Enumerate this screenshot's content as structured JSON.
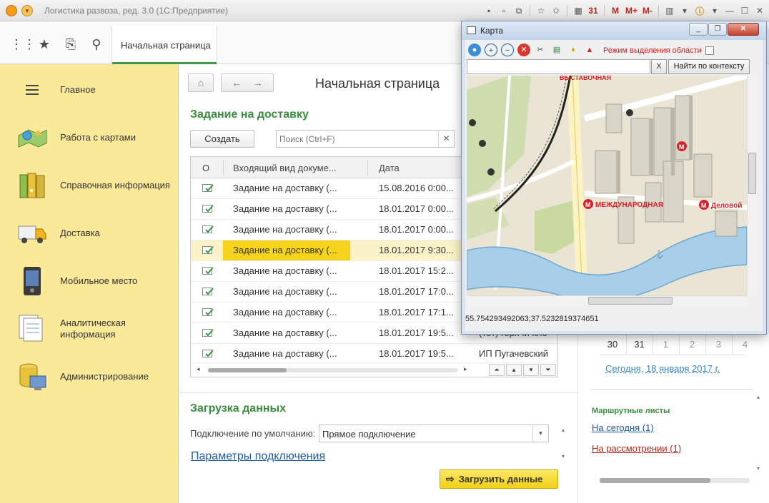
{
  "window": {
    "title": "Логистика развоза, ред. 3.0 (1С:Предприятие)",
    "toolbar_labels": [
      "M",
      "M+",
      "M-"
    ]
  },
  "toppanel": {
    "home_tab_label": "Начальная страница"
  },
  "sidebar": {
    "items": [
      {
        "label": "Главное",
        "icon": "menu-icon"
      },
      {
        "label": "Работа с картами",
        "icon": "map-icon"
      },
      {
        "label": "Справочная информация",
        "icon": "binders-icon"
      },
      {
        "label": "Доставка",
        "icon": "truck-icon"
      },
      {
        "label": "Мобильное место",
        "icon": "mobile-device-icon"
      },
      {
        "label": "Аналитическая информация",
        "icon": "documents-icon"
      },
      {
        "label": "Администрирование",
        "icon": "database-admin-icon"
      }
    ]
  },
  "main": {
    "page_title": "Начальная страница",
    "delivery": {
      "title": "Задание на доставку",
      "create_label": "Создать",
      "search_placeholder": "Поиск (Ctrl+F)",
      "columns": [
        "О",
        "Входящий вид докуме...",
        "Дата"
      ],
      "rows": [
        {
          "type": "Задание на доставку (...",
          "date": "15.08.2016 0:00...",
          "extra": ""
        },
        {
          "type": "Задание на доставку (...",
          "date": "18.01.2017 0:00...",
          "extra": ""
        },
        {
          "type": "Задание на доставку (...",
          "date": "18.01.2017 0:00...",
          "extra": ""
        },
        {
          "type": "Задание на доставку (...",
          "date": "18.01.2017 9:30...",
          "extra": "",
          "selected": true
        },
        {
          "type": "Задание на доставку (...",
          "date": "18.01.2017 15:2...",
          "extra": ""
        },
        {
          "type": "Задание на доставку (...",
          "date": "18.01.2017 17:0...",
          "extra": ""
        },
        {
          "type": "Задание на доставку (...",
          "date": "18.01.2017 17:1...",
          "extra": ""
        },
        {
          "type": "Задание на доставку (...",
          "date": "18.01.2017 19:5...",
          "extra": "(тот) горячи хле"
        },
        {
          "type": "Задание на доставку (...",
          "date": "18.01.2017 19:5...",
          "extra": "ИП Пугачевский"
        }
      ]
    },
    "load": {
      "title": "Загрузка данных",
      "connection_label": "Подключение по умолчанию:",
      "connection_value": "Прямое подключение",
      "params_link": "Параметры подключения",
      "load_button": "Загрузить данные"
    }
  },
  "right": {
    "calendar_days": [
      {
        "day": "30",
        "current": true
      },
      {
        "day": "31",
        "current": true
      },
      {
        "day": "1",
        "current": false
      },
      {
        "day": "2",
        "current": false
      },
      {
        "day": "3",
        "current": false
      },
      {
        "day": "4",
        "current": false
      }
    ],
    "today_link": "Сегодня, 18 января 2017 г.",
    "routes_title": "Маршрутные листы",
    "routes_today": "На сегодня (1)",
    "routes_review": "На рассмотрении (1)",
    "colors": {
      "link_blue": "#1d5a9e",
      "link_red": "#b5281c"
    }
  },
  "map": {
    "title": "Карта",
    "mode_label": "Режим выделения области",
    "clear_label": "X",
    "find_label": "Найти по контексту",
    "coords": "55.754293492063;37.5232819374651",
    "labels": {
      "top_station": "ВЫСТАВОЧНАЯ",
      "station1": "МЕЖДУНАРОДНАЯ",
      "station2": "Деловой"
    },
    "colors": {
      "river": "#a9cfe8",
      "water_edge": "#6aa6d2",
      "building": "#d9d5c8",
      "road": "#ffffff",
      "metro": "#d2222d"
    }
  }
}
